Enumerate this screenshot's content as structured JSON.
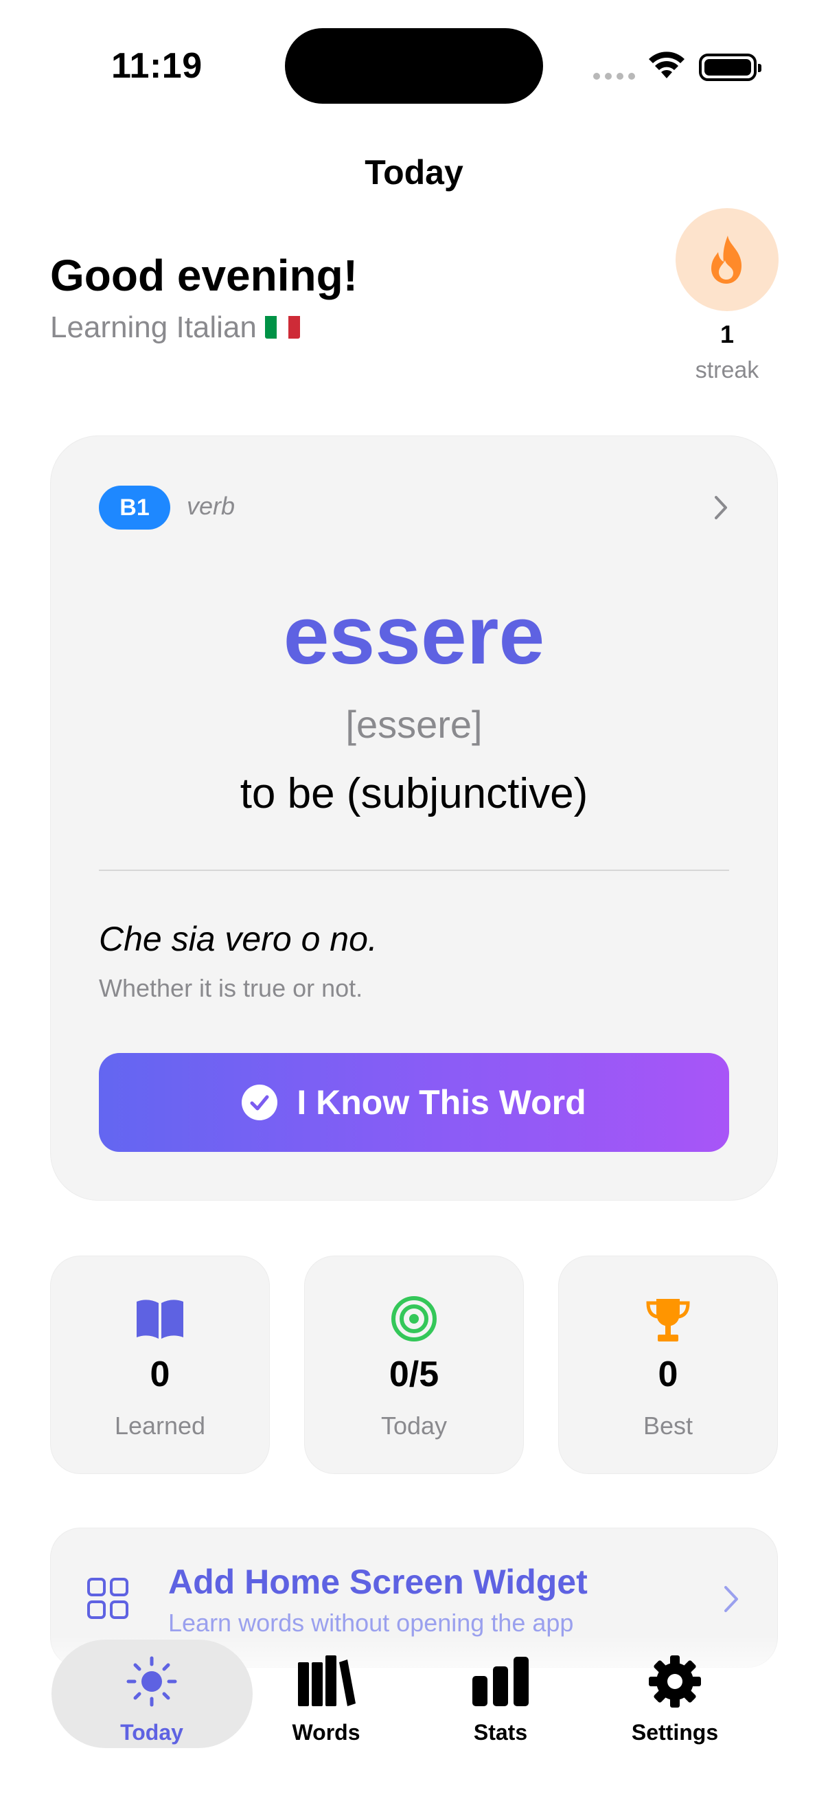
{
  "status_bar": {
    "time": "11:19"
  },
  "nav": {
    "title": "Today"
  },
  "header": {
    "greeting": "Good evening!",
    "subtitle": "Learning Italian",
    "streak_count": "1",
    "streak_label": "streak"
  },
  "word_card": {
    "level": "B1",
    "part_of_speech": "verb",
    "word": "essere",
    "pronunciation": "[essere]",
    "translation": "to be (subjunctive)",
    "example": "Che sia vero o no.",
    "example_translation": "Whether it is true or not.",
    "know_button_label": "I Know This Word"
  },
  "stats": [
    {
      "value": "0",
      "label": "Learned",
      "icon": "book-icon",
      "color": "#5e62e2"
    },
    {
      "value": "0/5",
      "label": "Today",
      "icon": "target-icon",
      "color": "#34c759"
    },
    {
      "value": "0",
      "label": "Best",
      "icon": "trophy-icon",
      "color": "#ff9500"
    }
  ],
  "widget_promo": {
    "title": "Add Home Screen Widget",
    "subtitle": "Learn words without opening the app"
  },
  "tabs": [
    {
      "label": "Today",
      "icon": "sun-icon",
      "selected": true
    },
    {
      "label": "Words",
      "icon": "books-icon",
      "selected": false
    },
    {
      "label": "Stats",
      "icon": "bar-chart-icon",
      "selected": false
    },
    {
      "label": "Settings",
      "icon": "gear-icon",
      "selected": false
    }
  ],
  "colors": {
    "accent": "#5e62e2",
    "badge_blue": "#1e88ff",
    "streak_bg": "#fde3cc",
    "streak_flame": "#ff8a2a",
    "card_bg": "#f4f4f4"
  }
}
